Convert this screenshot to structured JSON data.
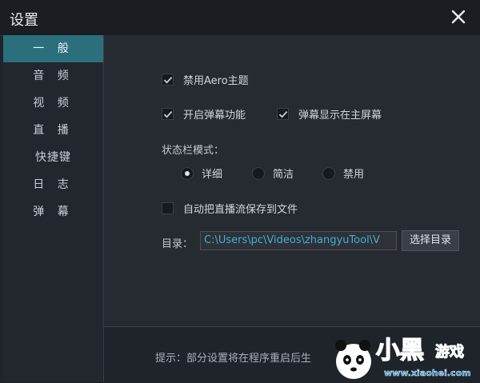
{
  "window": {
    "title": "设置"
  },
  "sidebar": {
    "items": [
      {
        "label": "一 般",
        "active": true
      },
      {
        "label": "音 频"
      },
      {
        "label": "视 频"
      },
      {
        "label": "直 播"
      },
      {
        "label": "快捷键"
      },
      {
        "label": "日 志"
      },
      {
        "label": "弹 幕"
      }
    ]
  },
  "general": {
    "disable_aero": {
      "label": "禁用Aero主题",
      "checked": true
    },
    "enable_danmaku": {
      "label": "开启弹幕功能",
      "checked": true
    },
    "danmaku_main_screen": {
      "label": "弹幕显示在主屏幕",
      "checked": true
    },
    "status_bar_mode": {
      "label": "状态栏模式：",
      "options": [
        "详细",
        "简洁",
        "禁用"
      ],
      "selected": "详细"
    },
    "auto_save_stream": {
      "label": "自动把直播流保存到文件",
      "checked": false
    },
    "directory": {
      "label": "目录：",
      "value": "C:\\Users\\pc\\Videos\\zhangyuTool\\V",
      "button": "选择目录"
    }
  },
  "footer": {
    "hint": "提示：部分设置将在程序重启后生"
  },
  "colors": {
    "accent": "#2b6e7c",
    "path_text": "#3fb3c6"
  },
  "icons": {
    "close": "close-icon",
    "check": "checkmark-icon"
  },
  "watermark": {
    "text": "小黑游戏",
    "url": "www.xiaohei.com"
  }
}
